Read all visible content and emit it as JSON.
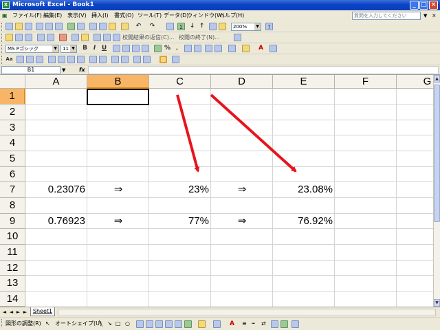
{
  "window": {
    "title": "Microsoft Excel - Book1",
    "app_icon": "X"
  },
  "menu": {
    "items": [
      "ファイル(F)",
      "編集(E)",
      "表示(V)",
      "挿入(I)",
      "書式(O)",
      "ツール(T)",
      "データ(D)",
      "ウィンドウ(W)",
      "ヘルプ(H)"
    ],
    "help_placeholder": "質問を入力してください"
  },
  "toolbar_standard": {
    "zoom": "200%"
  },
  "toolbar_review": {
    "reply_label": "校閲結果の返信(C)...",
    "end_review_label": "校閲の終了(N)..."
  },
  "toolbar_format": {
    "font": "MS Pゴシック",
    "size": "11"
  },
  "formula": {
    "name_box": "B1",
    "fx": "fx",
    "content": ""
  },
  "grid": {
    "columns": [
      "A",
      "B",
      "C",
      "D",
      "E",
      "F",
      "G"
    ],
    "selected_column": "B",
    "rows": [
      "1",
      "2",
      "3",
      "4",
      "5",
      "6",
      "7",
      "8",
      "9",
      "10",
      "11",
      "12",
      "13",
      "14"
    ],
    "selected_row": "1",
    "row7": {
      "a": "0.23076",
      "b": "⇒",
      "c": "23%",
      "d": "⇒",
      "e": "23.08%"
    },
    "row9": {
      "a": "0.76923",
      "b": "⇒",
      "c": "77%",
      "d": "⇒",
      "e": "76.92%"
    },
    "annotation_color": "#e8141b"
  },
  "sheets": {
    "tabs": [
      "Sheet1"
    ]
  },
  "drawing": {
    "draw_label": "図形の調整(R)",
    "autoshapes_label": "オートシェイプ(U)"
  }
}
